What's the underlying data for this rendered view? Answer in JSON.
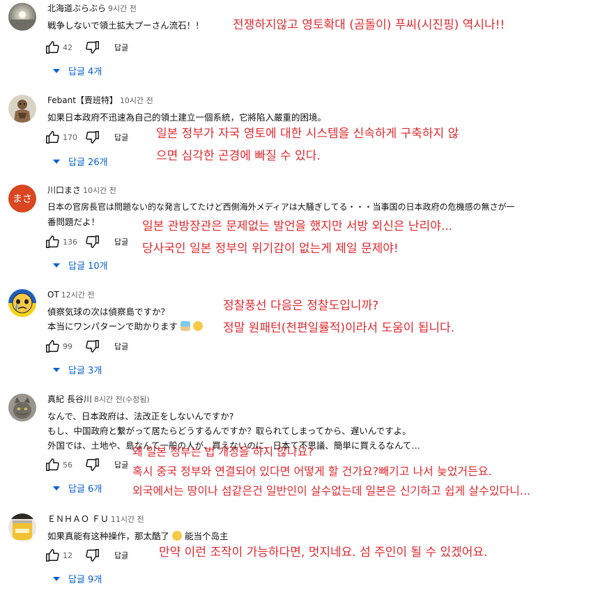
{
  "comments": [
    {
      "author": "北海道ぶらぶら",
      "time": "9시간 전",
      "lines": [
        "戦争しないで領土拡大プーさん流石！！"
      ],
      "likes": "42",
      "reply_label": "답글",
      "replies_label": "답글 4개",
      "translation": [
        "전쟁하지않고 영토확대 (곰돌이) 푸씨(시진핑) 역시나!!"
      ],
      "avatar": "sunset-sea"
    },
    {
      "author": "Febant【賣班特】",
      "time": "10시간 전",
      "lines": [
        "如果日本政府不迅速為自己的領土建立一個系統，它將陷入嚴重的困境。"
      ],
      "likes": "170",
      "reply_label": "답글",
      "replies_label": "답글 26개",
      "translation": [
        "일본 정부가 자국 영토에 대한 시스템을 신속하게 구축하지 않",
        "으면 심각한 곤경에 빠질 수 있다."
      ],
      "avatar": "armored-figure"
    },
    {
      "author": "川口まさ",
      "time": "10시간 전",
      "lines": [
        "日本の官房長官は問題ない的な発言してたけど西側海外メディアは大騒ぎしてる・・・当事国の日本政府の危機感の無さが一",
        "番問題だよ！"
      ],
      "likes": "136",
      "reply_label": "답글",
      "replies_label": "답글 10개",
      "avatar_text": "まさ",
      "translation": [
        "일본 관방장관은 문제없는 발언을 했지만 서방 외신은 난리야...",
        "당사국인 일본 정부의 위기감이 없는게 제일 문제야!"
      ],
      "avatar": "initials"
    },
    {
      "author": "OT",
      "time": "12시간 전",
      "lines": [
        "偵察気球の次は偵察島ですか？",
        "本当にワンパターンで助かります"
      ],
      "likes": "99",
      "reply_label": "답글",
      "replies_label": "답글 3개",
      "translation": [
        "정찰풍선 다음은 정찰도입니까?",
        "정말 원패턴(천편일률적)이라서 도움이 됩니다."
      ],
      "avatar": "crying-face"
    },
    {
      "author": "真紀 長谷川",
      "time": "8시간 전(수정됨)",
      "lines": [
        "なんで、日本政府は、法改正をしないんですか?",
        "もし、中国政府と繋がって居たらどうするんですか？取られてしまってから、遅いんですよ。",
        "外国では、土地や、島なんて一般の人が、買えないのに、日本て不思議、簡単に買えるなんて…"
      ],
      "likes": "56",
      "reply_label": "답글",
      "replies_label": "답글 6개",
      "translation": [
        "왜 일본 정부는 법 개정을 하지 않나요?",
        "혹시 중국 정부와 연결되어 있다면 어떻게 할 건가요?빼기고 나서 늦었거든요.",
        "외국에서는 땅이나 섬같은건 일반인이 살수없는데 일본은 신기하고 쉽게 살수있다니..."
      ],
      "avatar": "cat-photo"
    },
    {
      "author": "ＥＮＨＡＯ ＦＵ",
      "time": "11시간 전",
      "lines": [
        "如果真能有这种操作，那太酷了",
        "能当个岛主"
      ],
      "likes": "12",
      "reply_label": "답글",
      "replies_label": "답글 9개",
      "translation": [
        "만약 이런 조작이 가능하다면, 멋지네요. 섬 주인이 될 수 있겠어요."
      ],
      "avatar": "yellow-jar"
    }
  ],
  "colors": {
    "link": "#065fd4",
    "translation": "#e0282e",
    "meta": "#606060"
  }
}
